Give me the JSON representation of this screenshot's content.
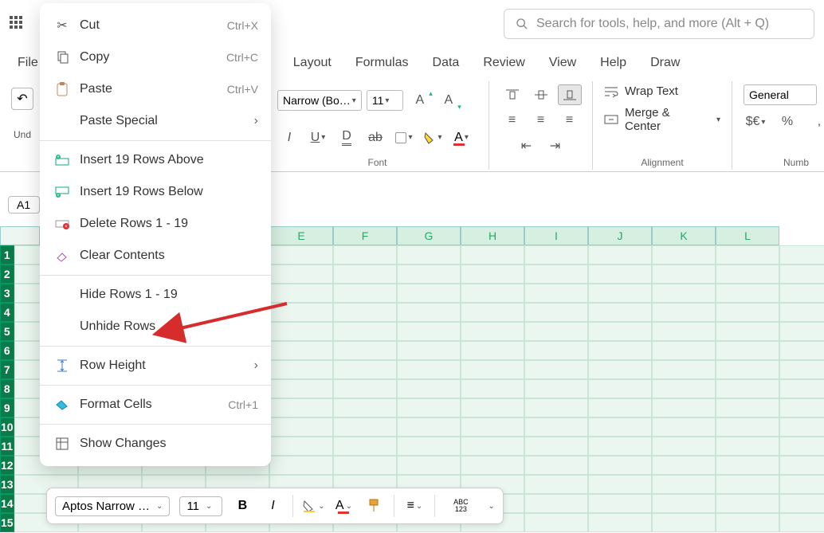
{
  "topbar": {
    "search_placeholder": "Search for tools, help, and more (Alt + Q)"
  },
  "menutabs": {
    "file": "File",
    "layout": "Layout",
    "formulas": "Formulas",
    "data": "Data",
    "review": "Review",
    "view": "View",
    "help": "Help",
    "draw": "Draw"
  },
  "undo_label": "Und",
  "ribbon": {
    "font_name": "Narrow (Bo…",
    "font_size": "11",
    "group_font": "Font",
    "wrap": "Wrap Text",
    "merge": "Merge & Center",
    "group_align": "Alignment",
    "numfmt": "General",
    "group_num": "Numb"
  },
  "namebox": "A1",
  "columns": [
    "E",
    "F",
    "G",
    "H",
    "I",
    "J",
    "K",
    "L"
  ],
  "rows": [
    "1",
    "2",
    "3",
    "4",
    "5",
    "6",
    "7",
    "8",
    "9",
    "10",
    "11",
    "12",
    "13",
    "14",
    "15"
  ],
  "ctx": {
    "cut": "Cut",
    "cut_sh": "Ctrl+X",
    "copy": "Copy",
    "copy_sh": "Ctrl+C",
    "paste": "Paste",
    "paste_sh": "Ctrl+V",
    "paste_special": "Paste Special",
    "ins_above": "Insert 19 Rows Above",
    "ins_below": "Insert 19 Rows Below",
    "delete_rows": "Delete Rows 1 - 19",
    "clear": "Clear Contents",
    "hide": "Hide Rows 1 - 19",
    "unhide": "Unhide Rows",
    "row_height": "Row Height",
    "format_cells": "Format Cells",
    "format_sh": "Ctrl+1",
    "show_changes": "Show Changes"
  },
  "minitb": {
    "font": "Aptos Narrow …",
    "size": "11",
    "abc": "ABC",
    "n123": "123"
  }
}
